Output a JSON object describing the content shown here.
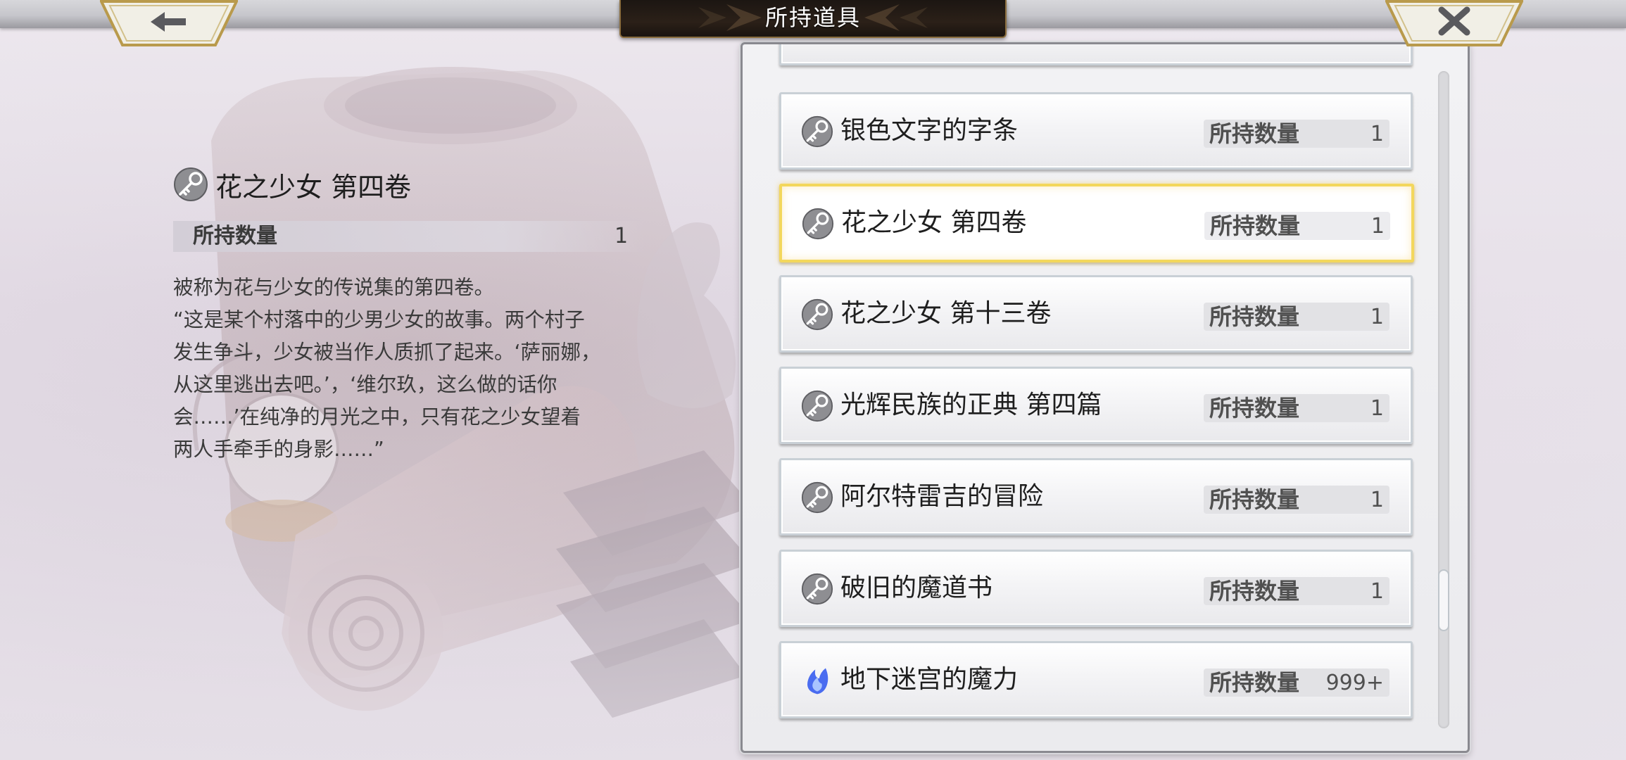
{
  "header": {
    "title": "所持道具",
    "back_icon": "arrow-left-icon",
    "close_icon": "close-x-icon"
  },
  "detail": {
    "icon": "key-icon",
    "name": "花之少女 第四卷",
    "qty_label": "所持数量",
    "qty_value": "1",
    "description": "被称为花与少女的传说集的第四卷。\n“这是某个村落中的少男少女的故事。两个村子\n发生争斗，少女被当作人质抓了起来。‘萨丽娜，\n从这里逃出去吧。’，‘维尔玖，这么做的话你\n会……’在纯净的月光之中，只有花之少女望着\n两人手牵手的身影……”"
  },
  "items": [
    {
      "icon": "key-icon",
      "name": "银色文字的字条",
      "qty_label": "所持数量",
      "qty": "1",
      "selected": false
    },
    {
      "icon": "key-icon",
      "name": "花之少女 第四卷",
      "qty_label": "所持数量",
      "qty": "1",
      "selected": true
    },
    {
      "icon": "key-icon",
      "name": "花之少女 第十三卷",
      "qty_label": "所持数量",
      "qty": "1",
      "selected": false
    },
    {
      "icon": "key-icon",
      "name": "光辉民族的正典 第四篇",
      "qty_label": "所持数量",
      "qty": "1",
      "selected": false
    },
    {
      "icon": "key-icon",
      "name": "阿尔特雷吉的冒险",
      "qty_label": "所持数量",
      "qty": "1",
      "selected": false
    },
    {
      "icon": "key-icon",
      "name": "破旧的魔道书",
      "qty_label": "所持数量",
      "qty": "1",
      "selected": false
    },
    {
      "icon": "blue-flame-icon",
      "name": "地下迷宫的魔力",
      "qty_label": "所持数量",
      "qty": "999+",
      "selected": false
    }
  ],
  "colors": {
    "selected_border": "#f3d75c",
    "title_plate": "#2b2018",
    "title_trim": "#8a6d3e"
  }
}
